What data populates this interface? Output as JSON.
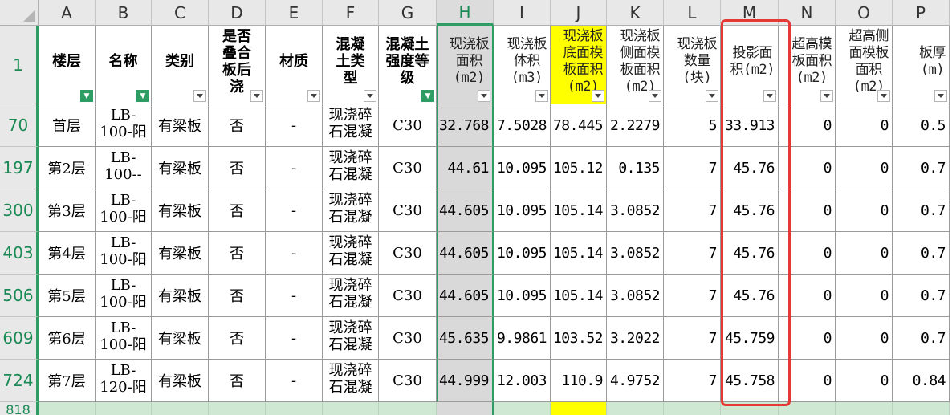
{
  "column_letters": [
    "A",
    "B",
    "C",
    "D",
    "E",
    "F",
    "G",
    "H",
    "I",
    "J",
    "K",
    "L",
    "M",
    "N",
    "O",
    "P"
  ],
  "header_row_number": "1",
  "headers": [
    "楼层",
    "名称",
    "类别",
    "是否\n叠合\n板后\n浇",
    "材质",
    "混凝\n土类\n型",
    "混凝土\n强度等\n级",
    "现浇板\n面积\n(m2)",
    "现浇板\n体积\n(m3)",
    "现浇板\n底面模\n板面积\n(m2)",
    "现浇板\n侧面模\n板面积\n(m2)",
    "现浇板\n数量\n(块)",
    "投影面\n积(m2)",
    "超高模\n板面积\n(m2)",
    "超高侧\n面模板\n面积\n(m2)",
    "板厚\n(m)"
  ],
  "filter_active_icon": "filter-icon",
  "rows": [
    {
      "row_number": "70",
      "cells": [
        "首层",
        "LB-\n100-阳",
        "有梁板",
        "否",
        "-",
        "现浇碎\n石混凝",
        "C30",
        "32.768",
        "7.5028",
        "78.445",
        "2.2279",
        "5",
        "33.913",
        "0",
        "0",
        "0.5"
      ]
    },
    {
      "row_number": "197",
      "cells": [
        "第2层",
        "LB-\n100--",
        "有梁板",
        "否",
        "-",
        "现浇碎\n石混凝",
        "C30",
        "44.61",
        "10.095",
        "105.12",
        "0.135",
        "7",
        "45.76",
        "0",
        "0",
        "0.7"
      ]
    },
    {
      "row_number": "300",
      "cells": [
        "第3层",
        "LB-\n100-阳",
        "有梁板",
        "否",
        "-",
        "现浇碎\n石混凝",
        "C30",
        "44.605",
        "10.095",
        "105.14",
        "3.0852",
        "7",
        "45.76",
        "0",
        "0",
        "0.7"
      ]
    },
    {
      "row_number": "403",
      "cells": [
        "第4层",
        "LB-\n100-阳",
        "有梁板",
        "否",
        "-",
        "现浇碎\n石混凝",
        "C30",
        "44.605",
        "10.095",
        "105.14",
        "3.0852",
        "7",
        "45.76",
        "0",
        "0",
        "0.7"
      ]
    },
    {
      "row_number": "506",
      "cells": [
        "第5层",
        "LB-\n100-阳",
        "有梁板",
        "否",
        "-",
        "现浇碎\n石混凝",
        "C30",
        "44.605",
        "10.095",
        "105.14",
        "3.0852",
        "7",
        "45.76",
        "0",
        "0",
        "0.7"
      ]
    },
    {
      "row_number": "609",
      "cells": [
        "第6层",
        "LB-\n100-阳",
        "有梁板",
        "否",
        "-",
        "现浇碎\n石混凝",
        "C30",
        "45.635",
        "9.9861",
        "103.52",
        "3.2022",
        "7",
        "45.759",
        "0",
        "0",
        "0.7"
      ]
    },
    {
      "row_number": "724",
      "cells": [
        "第7层",
        "LB-\n120-阳",
        "有梁板",
        "否",
        "-",
        "现浇碎\n石混凝",
        "C30",
        "44.999",
        "12.003",
        "110.9",
        "4.9752",
        "7",
        "45.758",
        "0",
        "0",
        "0.84"
      ]
    }
  ],
  "partial_row_number": "818",
  "colors": {
    "accent_green": "#2e9d63",
    "selected_column": "#d9d9d9",
    "highlight_yellow": "#ffff00",
    "partial_row": "#cfe8d4",
    "annotation_red": "#e53935"
  }
}
